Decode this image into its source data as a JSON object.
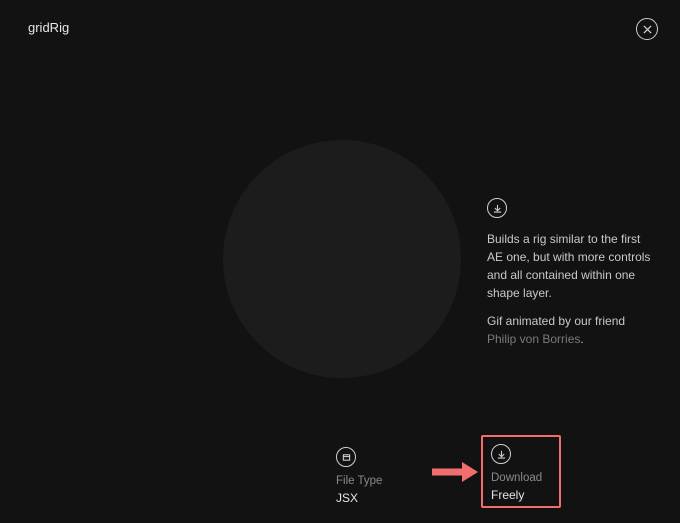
{
  "header": {
    "title": "gridRig"
  },
  "description": {
    "body": "Builds a rig similar to the first AE one, but with more controls and all contained within one shape layer.",
    "credit_prefix": "Gif animated by our friend ",
    "credit_name": "Philip von Borries",
    "credit_suffix": "."
  },
  "meta": {
    "file_type_label": "File Type",
    "file_type_value": "JSX",
    "download_label": "Download",
    "download_value": "Freely"
  },
  "colors": {
    "highlight": "#f26d6d",
    "background": "#121212"
  }
}
